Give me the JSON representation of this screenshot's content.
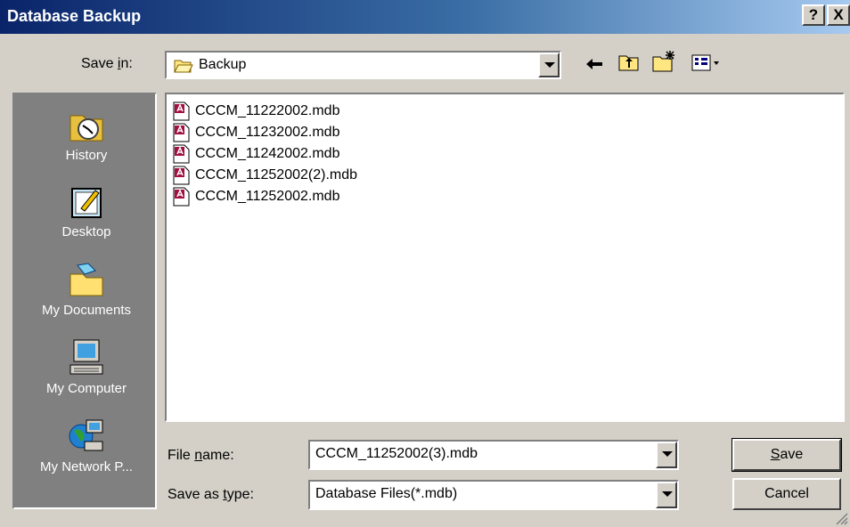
{
  "window": {
    "title": "Database Backup",
    "help_btn": "?",
    "close_btn": "X"
  },
  "savein": {
    "label_pre": "Save ",
    "label_u": "i",
    "label_post": "n:",
    "value": "Backup",
    "value_icon": "folder-open-icon"
  },
  "toolbar": {
    "back_icon": "back-arrow-icon",
    "up_icon": "up-one-level-icon",
    "newfolder_icon": "new-folder-icon",
    "views_icon": "view-menu-icon"
  },
  "places": [
    {
      "label": "History",
      "icon": "history-icon"
    },
    {
      "label": "Desktop",
      "icon": "desktop-icon"
    },
    {
      "label": "My Documents",
      "icon": "my-documents-icon"
    },
    {
      "label": "My Computer",
      "icon": "my-computer-icon"
    },
    {
      "label": "My Network P...",
      "icon": "network-places-icon"
    }
  ],
  "files": [
    "CCCM_11222002.mdb",
    "CCCM_11232002.mdb",
    "CCCM_11242002.mdb",
    "CCCM_11252002(2).mdb",
    "CCCM_11252002.mdb"
  ],
  "filename": {
    "label_pre": "File ",
    "label_u": "n",
    "label_post": "ame:",
    "value": "CCCM_11252002(3).mdb"
  },
  "filetype": {
    "label_pre": "Save as ",
    "label_u": "t",
    "label_post": "ype:",
    "value": "Database Files(*.mdb)"
  },
  "buttons": {
    "save_u": "S",
    "save_rest": "ave",
    "cancel": "Cancel"
  }
}
